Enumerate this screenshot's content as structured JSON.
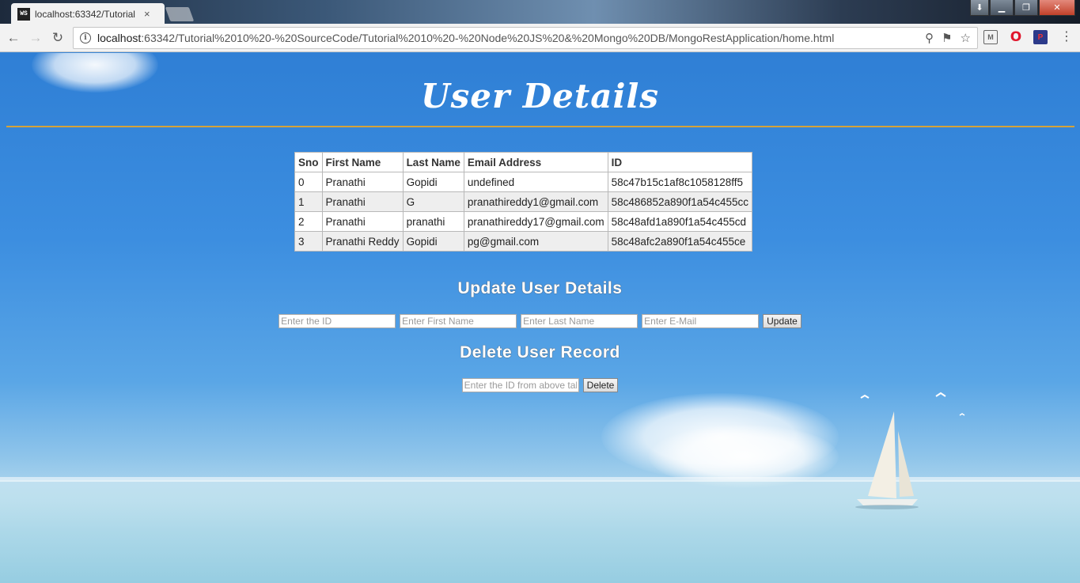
{
  "browser": {
    "tab_title": "localhost:63342/Tutorial",
    "tab_favicon": "WS",
    "tab_close": "×",
    "url_host": "localhost",
    "url_path": ":63342/Tutorial%2010%20-%20SourceCode/Tutorial%2010%20-%20Node%20JS%20&%20Mongo%20DB/MongoRestApplication/home.html",
    "ext_m": "M",
    "ext_o": "O",
    "ext_p": "P"
  },
  "page": {
    "title": "User Details",
    "table": {
      "headers": [
        "Sno",
        "First Name",
        "Last Name",
        "Email Address",
        "ID"
      ],
      "rows": [
        [
          "0",
          "Pranathi",
          "Gopidi",
          "undefined",
          "58c47b15c1af8c1058128ff5"
        ],
        [
          "1",
          "Pranathi",
          "G",
          "pranathireddy1@gmail.com",
          "58c486852a890f1a54c455cc"
        ],
        [
          "2",
          "Pranathi",
          "pranathi",
          "pranathireddy17@gmail.com",
          "58c48afd1a890f1a54c455cd"
        ],
        [
          "3",
          "Pranathi Reddy",
          "Gopidi",
          "pg@gmail.com",
          "58c48afc2a890f1a54c455ce"
        ]
      ]
    },
    "update_section": {
      "heading": "Update User Details",
      "id_placeholder": "Enter the ID",
      "first_name_placeholder": "Enter First Name",
      "last_name_placeholder": "Enter Last Name",
      "email_placeholder": "Enter E-Mail",
      "button_label": "Update"
    },
    "delete_section": {
      "heading": "Delete User Record",
      "id_placeholder": "Enter the ID from above table",
      "button_label": "Delete"
    }
  },
  "colors": {
    "title_rule": "#d4a23a",
    "sky_top": "#2f7fd5",
    "sea": "#96cde1"
  }
}
